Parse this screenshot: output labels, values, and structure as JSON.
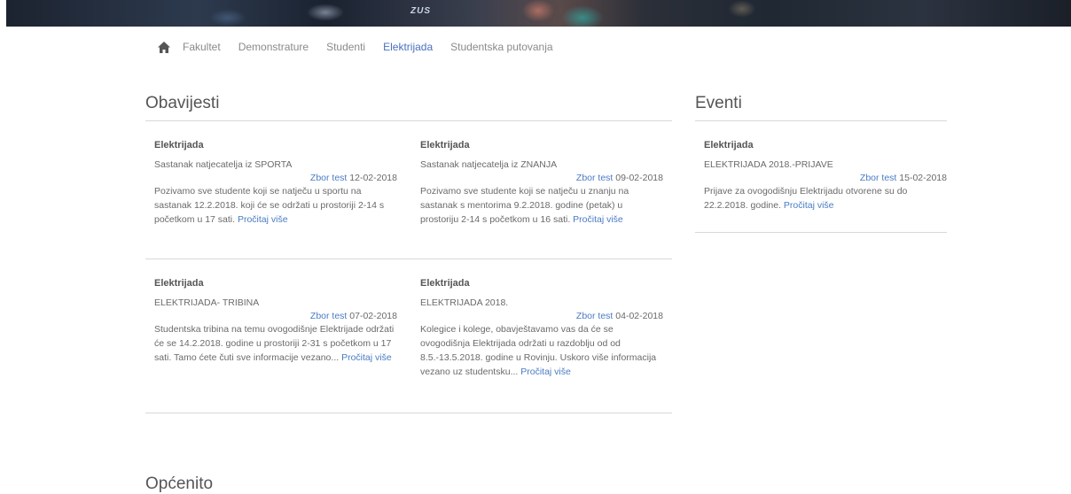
{
  "hero": {
    "banner_text": "ZUS"
  },
  "nav": {
    "items": [
      {
        "label": "Fakultet",
        "active": false
      },
      {
        "label": "Demonstrature",
        "active": false
      },
      {
        "label": "Studenti",
        "active": false
      },
      {
        "label": "Elektrijada",
        "active": true
      },
      {
        "label": "Studentska putovanja",
        "active": false
      }
    ]
  },
  "obavijesti": {
    "title": "Obavijesti",
    "cards": [
      {
        "category": "Elektrijada",
        "subject": "Sastanak natjecatelja iz SPORTA",
        "author": "Zbor test",
        "date": " 12-02-2018",
        "body": "Pozivamo sve studente koji se natječu u sportu na sastanak 12.2.2018. koji će se održati u prostoriji 2-14 s početkom u 17 sati. ",
        "more": "Pročitaj više"
      },
      {
        "category": "Elektrijada",
        "subject": "Sastanak natjecatelja iz ZNANJA",
        "author": "Zbor test",
        "date": " 09-02-2018",
        "body": "Pozivamo sve studente koji se natječu u znanju na sastanak s mentorima 9.2.2018. godine (petak) u prostoriju 2-14 s početkom u 16 sati. ",
        "more": "Pročitaj više"
      },
      {
        "category": "Elektrijada",
        "subject": "ELEKTRIJADA- TRIBINA",
        "author": "Zbor test",
        "date": " 07-02-2018",
        "body": "Studentska tribina na temu ovogodišnje Elektrijade održati će se 14.2.2018. godine u prostoriji 2-31 s početkom u 17 sati. Tamo ćete čuti sve informacije vezano... ",
        "more": "Pročitaj više"
      },
      {
        "category": "Elektrijada",
        "subject": "ELEKTRIJADA 2018.",
        "author": "Zbor test",
        "date": " 04-02-2018",
        "body": "Kolegice i kolege, obavještavamo vas da će se ovogodišnja Elektrijada održati u razdoblju od od 8.5.-13.5.2018. godine u Rovinju. Uskoro više informacija vezano uz studentsku... ",
        "more": "Pročitaj više"
      }
    ]
  },
  "eventi": {
    "title": "Eventi",
    "cards": [
      {
        "category": "Elektrijada",
        "subject": "ELEKTRIJADA 2018.-PRIJAVE",
        "author": "Zbor test",
        "date": " 15-02-2018",
        "body": "Prijave za ovogodišnju Elektrijadu otvorene su do 22.2.2018. godine. ",
        "more": "Pročitaj više"
      }
    ]
  },
  "opcenito": {
    "title": "Općenito"
  }
}
